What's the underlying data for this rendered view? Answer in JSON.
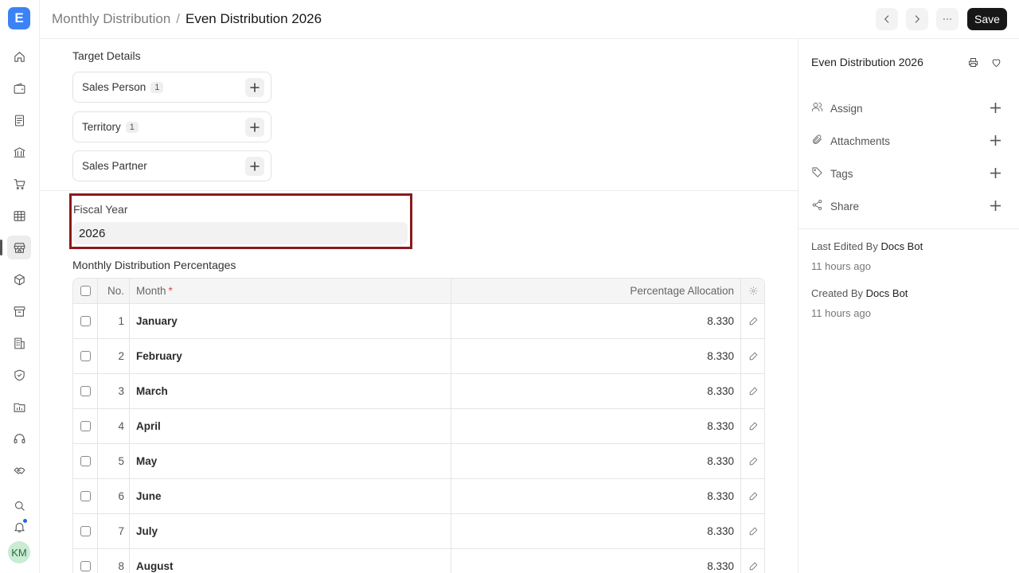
{
  "sidebar": {
    "logo_letter": "E",
    "items": [
      {
        "icon": "home-icon"
      },
      {
        "icon": "wallet-icon"
      },
      {
        "icon": "document-icon"
      },
      {
        "icon": "bank-icon"
      },
      {
        "icon": "cart-icon"
      },
      {
        "icon": "table-icon"
      },
      {
        "icon": "store-icon",
        "active": true
      },
      {
        "icon": "package-icon"
      },
      {
        "icon": "archive-icon"
      },
      {
        "icon": "building-icon"
      },
      {
        "icon": "shield-icon"
      },
      {
        "icon": "folder-chart-icon"
      },
      {
        "icon": "headset-icon"
      },
      {
        "icon": "handshake-icon"
      }
    ],
    "avatar_initials": "KM"
  },
  "header": {
    "breadcrumb_parent": "Monthly Distribution",
    "breadcrumb_separator": "/",
    "breadcrumb_current": "Even Distribution 2026",
    "save_label": "Save"
  },
  "target_details": {
    "title": "Target Details",
    "items": [
      {
        "label": "Sales Person",
        "count": "1"
      },
      {
        "label": "Territory",
        "count": "1"
      },
      {
        "label": "Sales Partner",
        "count": ""
      }
    ]
  },
  "fiscal_year": {
    "label": "Fiscal Year",
    "value": "2026",
    "highlight_color": "#8b1a1a"
  },
  "distribution_table": {
    "title": "Monthly Distribution Percentages",
    "columns": {
      "no": "No.",
      "month": "Month",
      "month_required": "*",
      "percentage": "Percentage Allocation"
    },
    "rows": [
      {
        "no": "1",
        "month": "January",
        "percentage": "8.330"
      },
      {
        "no": "2",
        "month": "February",
        "percentage": "8.330"
      },
      {
        "no": "3",
        "month": "March",
        "percentage": "8.330"
      },
      {
        "no": "4",
        "month": "April",
        "percentage": "8.330"
      },
      {
        "no": "5",
        "month": "May",
        "percentage": "8.330"
      },
      {
        "no": "6",
        "month": "June",
        "percentage": "8.330"
      },
      {
        "no": "7",
        "month": "July",
        "percentage": "8.330"
      },
      {
        "no": "8",
        "month": "August",
        "percentage": "8.330"
      }
    ]
  },
  "side_panel": {
    "doc_title": "Even Distribution 2026",
    "actions": [
      {
        "icon": "user-icon",
        "label": "Assign"
      },
      {
        "icon": "paperclip-icon",
        "label": "Attachments"
      },
      {
        "icon": "tag-icon",
        "label": "Tags"
      },
      {
        "icon": "share-icon",
        "label": "Share"
      }
    ],
    "last_edited_prefix": "Last Edited By",
    "last_edited_by": "Docs Bot",
    "last_edited_time": "11 hours ago",
    "created_prefix": "Created By",
    "created_by": "Docs Bot",
    "created_time": "11 hours ago"
  },
  "colors": {
    "brand": "#3b82f6",
    "save_button": "#171717",
    "required": "#e5484d"
  }
}
